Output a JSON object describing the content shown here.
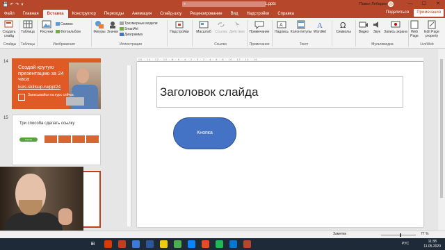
{
  "window": {
    "title": "100 уроков PowerPoint v1.pptx",
    "search_icon": "search-icon",
    "user": "Павел Лебедев",
    "min": "—",
    "max": "☐",
    "close": "✕"
  },
  "qat": {
    "save": "💾",
    "undo": "↶",
    "redo": "↷",
    "more": "▾"
  },
  "tabs": [
    "Файл",
    "Главная",
    "Вставка",
    "Конструктор",
    "Переходы",
    "Анимация",
    "Слайд-шоу",
    "Рецензирование",
    "Вид",
    "Надстройки",
    "Справка"
  ],
  "active_tab": "Вставка",
  "share_label": "Поделиться",
  "comments_label": "Примечания",
  "ribbon": {
    "create_slide": "Создать слайд",
    "table": "Таблица",
    "pictures": "Рисунки",
    "screenshot": "Снимок",
    "photo_album": "Фотоальбом",
    "shapes": "Фигуры",
    "icons": "Значки",
    "models_3d": "Трехмерные модели",
    "smartart": "SmartArt",
    "chart": "Диаграмма",
    "addins": "Надстройки",
    "zoom": "Масштаб",
    "link": "Ссылка",
    "action": "Действие",
    "comment": "Примечание",
    "textbox": "Надпись",
    "header_footer": "Колонтитулы",
    "wordart": "WordArt",
    "symbols": "Символы",
    "video": "Видео",
    "audio": "Звук",
    "screen_recording": "Запись экрана",
    "web_page": "Web Page",
    "edit_page": "Edit Page property",
    "groups": {
      "slides": "Слайды",
      "tables": "Таблицы",
      "images": "Изображения",
      "illustrations": "Иллюстрации",
      "links": "Ссылки",
      "comments": "Примечания",
      "text": "Текст",
      "media": "Мультимедиа",
      "liveweb": "LiveWeb"
    }
  },
  "thumbnails": {
    "slide14_num": "14",
    "slide14_title": "Создай крутую презентацию за 24 часа",
    "slide14_link": "kurs.skillsup.ru/ppt24",
    "slide14_cta": "Записывайся на курс сейчас",
    "slide15_num": "15",
    "slide15_title": "Три способа сделать ссылку",
    "slide15_btn": "Кнопка"
  },
  "slide": {
    "title": "Заголовок слайда",
    "button_label": "Кнопка"
  },
  "ruler_h": "16 · 14 · 12 · 10 · 8 · 6 · 4 · 2 · 0 · 2 · 4 · 6 · 8 · 10 · 12 · 14 · 16",
  "status": {
    "notes": "Заметки",
    "zoom": "77 %"
  },
  "taskbar": {
    "lang": "РУС",
    "time": "11:38",
    "date": "11.05.2020"
  },
  "colors": {
    "accent": "#b7472a",
    "button_fill": "#4472c4"
  }
}
